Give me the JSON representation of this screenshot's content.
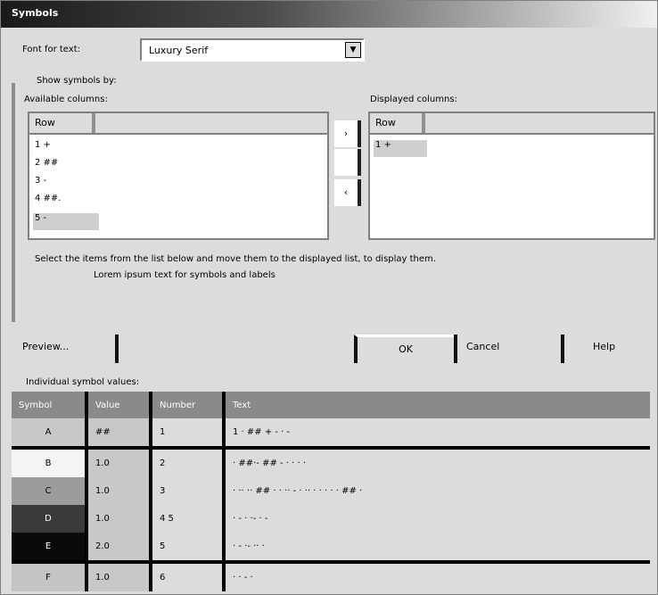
{
  "window": {
    "title": "Symbols"
  },
  "font": {
    "label": "Font for text:",
    "value": "Luxury Serif"
  },
  "group_label": "Show symbols by:",
  "available": {
    "label": "Available columns:",
    "header": "Row",
    "items": [
      "1 +",
      "2 ##",
      "3 -",
      "4 ##.",
      "5 -"
    ]
  },
  "displayed": {
    "label": "Displayed columns:",
    "header": "Row",
    "items": [
      "1 +"
    ]
  },
  "move_buttons": {
    "add": "›",
    "remove": "",
    "back": "‹"
  },
  "hint": {
    "line1": "Select the items from the list below and move them to the displayed list, to display them.",
    "line2": "Lorem ipsum text for symbols and labels"
  },
  "buttons": {
    "preview": "Preview...",
    "ok": "OK",
    "cancel": "Cancel",
    "help": "Help"
  },
  "table_label": "Individual symbol values:",
  "table": {
    "headers": [
      "Symbol",
      "Value",
      "Number",
      "Text"
    ],
    "rows": [
      {
        "cells": [
          "A",
          "##",
          "1",
          "1 ·    ##   +             -       ·     -"
        ],
        "bg": "#c8c8c8",
        "fg": "#000",
        "sep": true
      },
      {
        "cells": [
          "B",
          "1.0",
          "2",
          "·    ##·-   ##              - ·  ·  ·   ·"
        ],
        "bg": "#f4f4f4",
        "fg": "#000",
        "sep": false
      },
      {
        "cells": [
          "C",
          "1.0",
          "3",
          "·  ·· ·· ##  · · ·· - · ·· ·  ·  ·  ·  · ## ·"
        ],
        "bg": "#9c9c9c",
        "fg": "#000",
        "sep": false
      },
      {
        "cells": [
          "D",
          "1.0",
          "4 5",
          "·    -    ·  ·-  ·  -"
        ],
        "bg": "#3a3a3a",
        "fg": "#fff",
        "sep": false
      },
      {
        "cells": [
          "E",
          "2.0",
          "5",
          "·    -   ·-  ··   ·"
        ],
        "bg": "#0a0a0a",
        "fg": "#fff",
        "sep": true
      },
      {
        "cells": [
          "F",
          "1.0",
          "6",
          "·  · -  ·"
        ],
        "bg": "#c4c4c4",
        "fg": "#000",
        "sep": false
      }
    ]
  }
}
